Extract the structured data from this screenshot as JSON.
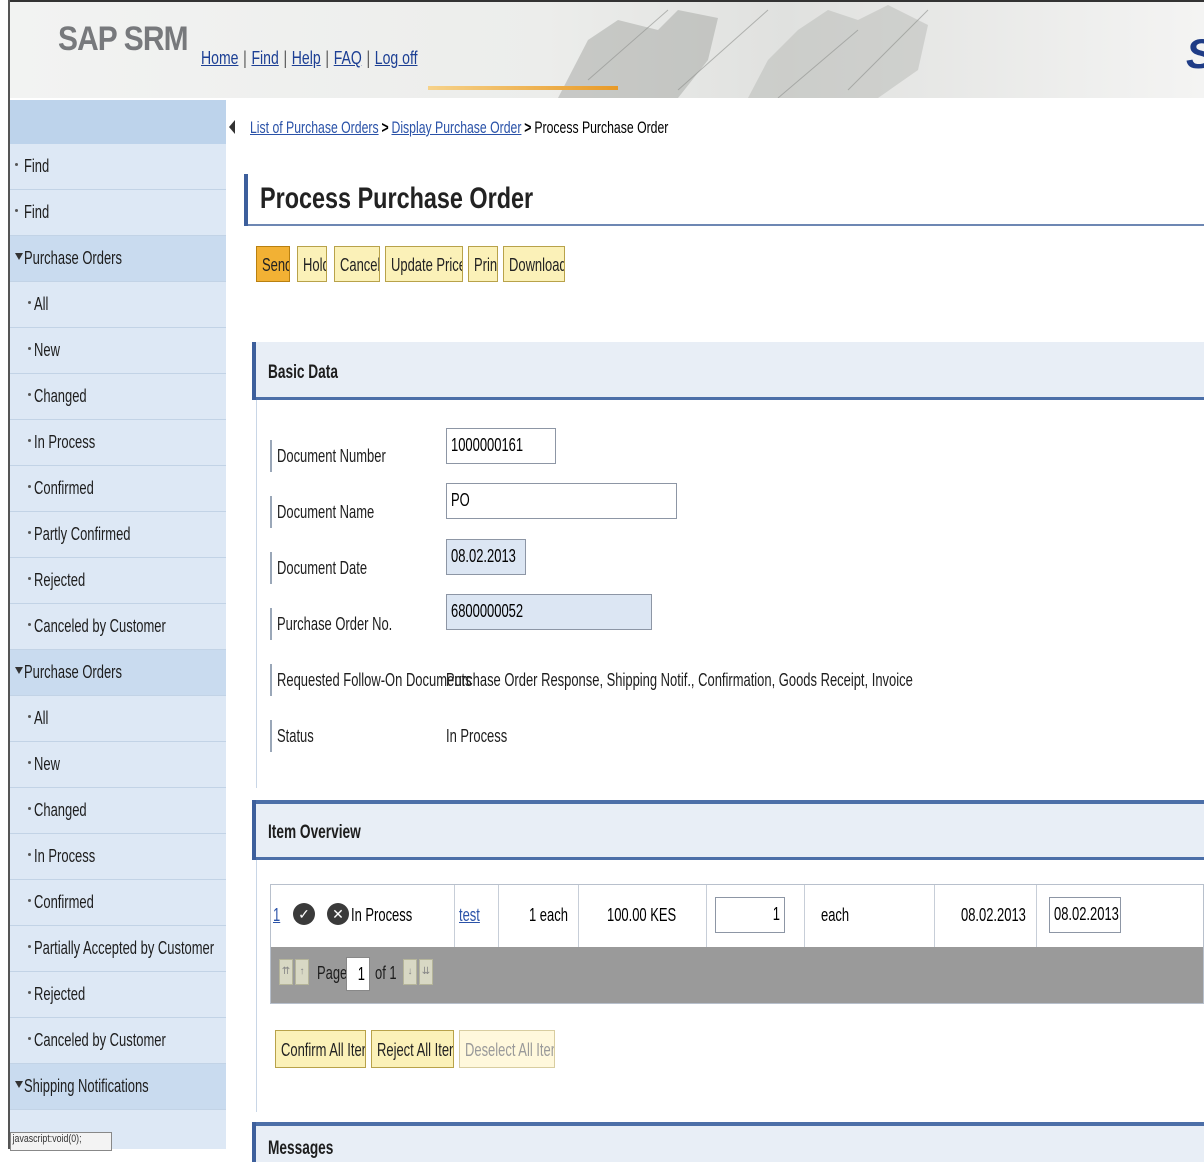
{
  "header": {
    "brand": "SAP SRM",
    "links": [
      "Home",
      "Find",
      "Help",
      "FAQ",
      "Log off"
    ],
    "logo": "SA"
  },
  "sidebar": {
    "items": [
      {
        "label": "Find",
        "level": 0,
        "kind": "bullet"
      },
      {
        "label": "Find",
        "level": 0,
        "kind": "bullet"
      },
      {
        "label": "Purchase Orders",
        "level": 0,
        "kind": "section"
      },
      {
        "label": "All",
        "level": 1,
        "kind": "bullet"
      },
      {
        "label": "New",
        "level": 1,
        "kind": "bullet"
      },
      {
        "label": "Changed",
        "level": 1,
        "kind": "bullet"
      },
      {
        "label": "In Process",
        "level": 1,
        "kind": "bullet"
      },
      {
        "label": "Confirmed",
        "level": 1,
        "kind": "bullet"
      },
      {
        "label": "Partly Confirmed",
        "level": 1,
        "kind": "bullet"
      },
      {
        "label": "Rejected",
        "level": 1,
        "kind": "bullet"
      },
      {
        "label": "Canceled by Customer",
        "level": 1,
        "kind": "bullet"
      },
      {
        "label": "Purchase Orders",
        "level": 0,
        "kind": "section"
      },
      {
        "label": "All",
        "level": 1,
        "kind": "bullet"
      },
      {
        "label": "New",
        "level": 1,
        "kind": "bullet"
      },
      {
        "label": "Changed",
        "level": 1,
        "kind": "bullet"
      },
      {
        "label": "In Process",
        "level": 1,
        "kind": "bullet"
      },
      {
        "label": "Confirmed",
        "level": 1,
        "kind": "bullet"
      },
      {
        "label": "Partially Accepted by Customer",
        "level": 1,
        "kind": "bullet"
      },
      {
        "label": "Rejected",
        "level": 1,
        "kind": "bullet"
      },
      {
        "label": "Canceled by Customer",
        "level": 1,
        "kind": "bullet"
      },
      {
        "label": "Shipping Notifications",
        "level": 0,
        "kind": "section"
      }
    ]
  },
  "status_bar": "javascript:void(0);",
  "breadcrumb": {
    "crumb1": "List of Purchase Orders",
    "crumb2": "Display Purchase Order",
    "current": "Process Purchase Order",
    "sep": ">"
  },
  "page_title": "Process Purchase Order",
  "toolbar": {
    "send": "Send",
    "hold": "Hold",
    "cancel": "Cancel",
    "update_prices": "Update Prices",
    "print": "Print",
    "download": "Download"
  },
  "basic_data": {
    "heading": "Basic Data",
    "document_number_label": "Document Number",
    "document_number": "1000000161",
    "document_name_label": "Document Name",
    "document_name": "PO",
    "document_date_label": "Document Date",
    "document_date": "08.02.2013",
    "po_number_label": "Purchase Order No.",
    "po_number": "6800000052",
    "followon_label": "Requested Follow-On Documents",
    "followon_value": "Purchase Order Response, Shipping Notif., Confirmation, Goods Receipt, Invoice",
    "status_label": "Status",
    "status_value": "In Process"
  },
  "item_overview": {
    "heading": "Item Overview",
    "row": {
      "item_no": "1",
      "status": "In Process",
      "description": "test",
      "qty": "1 each",
      "price": "100.00 KES",
      "confirmed_qty": "1",
      "unit": "each",
      "delivery_date": "08.02.2013",
      "confirmed_date": "08.02.2013"
    },
    "pager": {
      "page_label": "Page",
      "page": "1",
      "of_label": "of 1"
    },
    "buttons": {
      "confirm_all": "Confirm All Items",
      "reject_all": "Reject All Items",
      "deselect_all": "Deselect All Items"
    }
  },
  "messages_heading": "Messages"
}
